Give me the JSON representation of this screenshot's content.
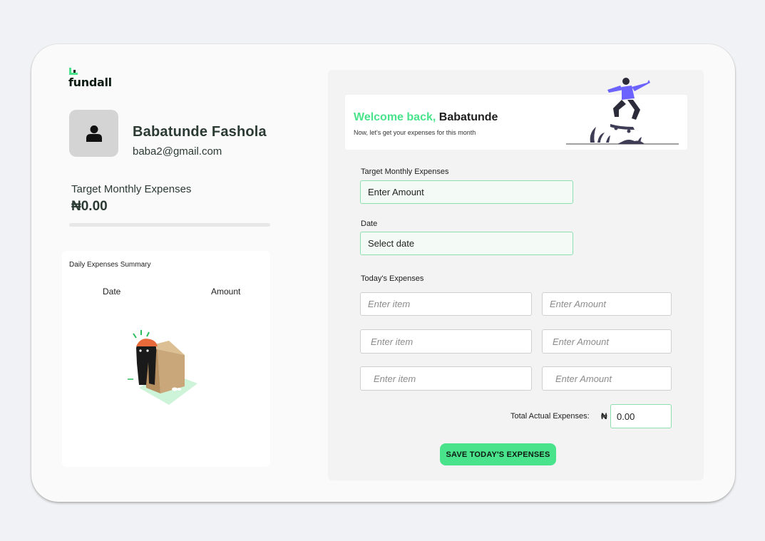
{
  "brand": {
    "name": "fundall",
    "accent": "#49e38b"
  },
  "user": {
    "name": "Babatunde Fashola",
    "email": "baba2@gmail.com",
    "avatar_icon": "user-icon"
  },
  "target": {
    "label": "Target Monthly Expenses",
    "value": "₦0.00",
    "progress_fraction": 0
  },
  "summary": {
    "title": "Daily Expenses Summary",
    "columns": [
      "Date",
      "Amount"
    ],
    "empty_illustration": "empty-box-illustration"
  },
  "welcome": {
    "greeting": "Welcome back,",
    "name": "Babatunde",
    "subtitle": "Now, let's get your expenses for this month",
    "illustration": "skater-illustration"
  },
  "form": {
    "target_label": "Target Monthly Expenses",
    "target_placeholder": "Enter Amount",
    "date_label": "Date",
    "date_placeholder": "Select date",
    "todays_label": "Today's Expenses",
    "item_placeholder": "Enter item",
    "amount_placeholder": "Enter Amount",
    "total_label": "Total Actual Expenses:",
    "currency": "₦",
    "total_value": "0.00",
    "save_label": "SAVE TODAY'S EXPENSES"
  }
}
